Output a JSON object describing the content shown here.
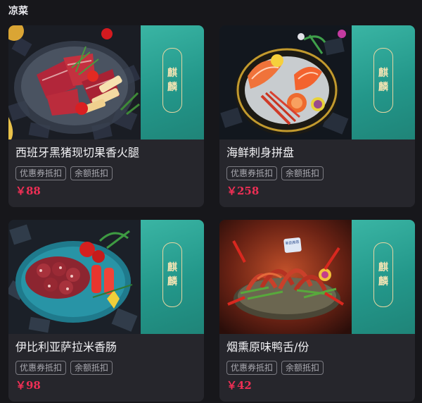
{
  "section": {
    "title": "凉菜"
  },
  "items": [
    {
      "name": "西班牙黑猪现切果香火腿",
      "price": "￥88",
      "tags": [
        "优惠券抵扣",
        "余额抵扣"
      ],
      "brand": "麒麟"
    },
    {
      "name": "海鲜刺身拼盘",
      "price": "￥258",
      "tags": [
        "优惠券抵扣",
        "余额抵扣"
      ],
      "brand": "麒麟"
    },
    {
      "name": "伊比利亚萨拉米香肠",
      "price": "￥98",
      "tags": [
        "优惠券抵扣",
        "余额抵扣"
      ],
      "brand": "麒麟"
    },
    {
      "name": "烟熏原味鸭舌/份",
      "price": "￥42",
      "tags": [
        "优惠券抵扣",
        "余额抵扣"
      ],
      "brand": "麒麟",
      "badge": "新品推荐"
    }
  ],
  "colors": {
    "background": "#17171b",
    "card": "#26262c",
    "price": "#ee2f55",
    "banner": "#2aa696",
    "seal": "#f1e3b3"
  }
}
